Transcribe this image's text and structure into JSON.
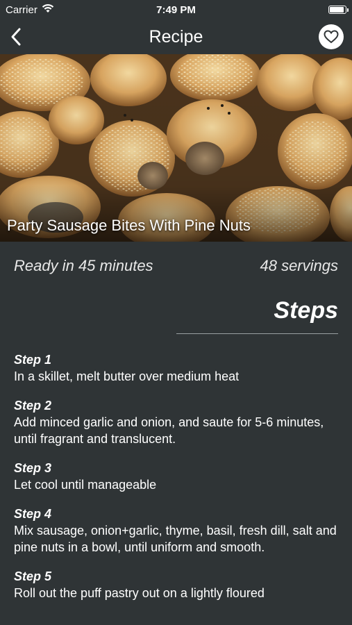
{
  "status_bar": {
    "carrier": "Carrier",
    "time": "7:49 PM"
  },
  "nav": {
    "title": "Recipe"
  },
  "recipe": {
    "title": "Party Sausage Bites With Pine Nuts",
    "ready_in": "Ready in 45 minutes",
    "servings": "48 servings"
  },
  "steps_heading": "Steps",
  "steps": [
    {
      "title": "Step 1",
      "text": "In a skillet, melt butter over medium heat"
    },
    {
      "title": "Step 2",
      "text": "Add minced garlic and onion, and saute for 5-6 minutes, until fragrant and translucent."
    },
    {
      "title": "Step 3",
      "text": "Let cool until manageable"
    },
    {
      "title": "Step 4",
      "text": "Mix sausage, onion+garlic, thyme, basil, fresh dill, salt and pine nuts in a bowl, until uniform and smooth."
    },
    {
      "title": "Step 5",
      "text": "Roll out the puff pastry out on a lightly floured"
    }
  ],
  "icons": {
    "wifi": "wifi-icon",
    "battery": "battery-icon",
    "back": "chevron-left-icon",
    "favorite": "heart-icon"
  }
}
